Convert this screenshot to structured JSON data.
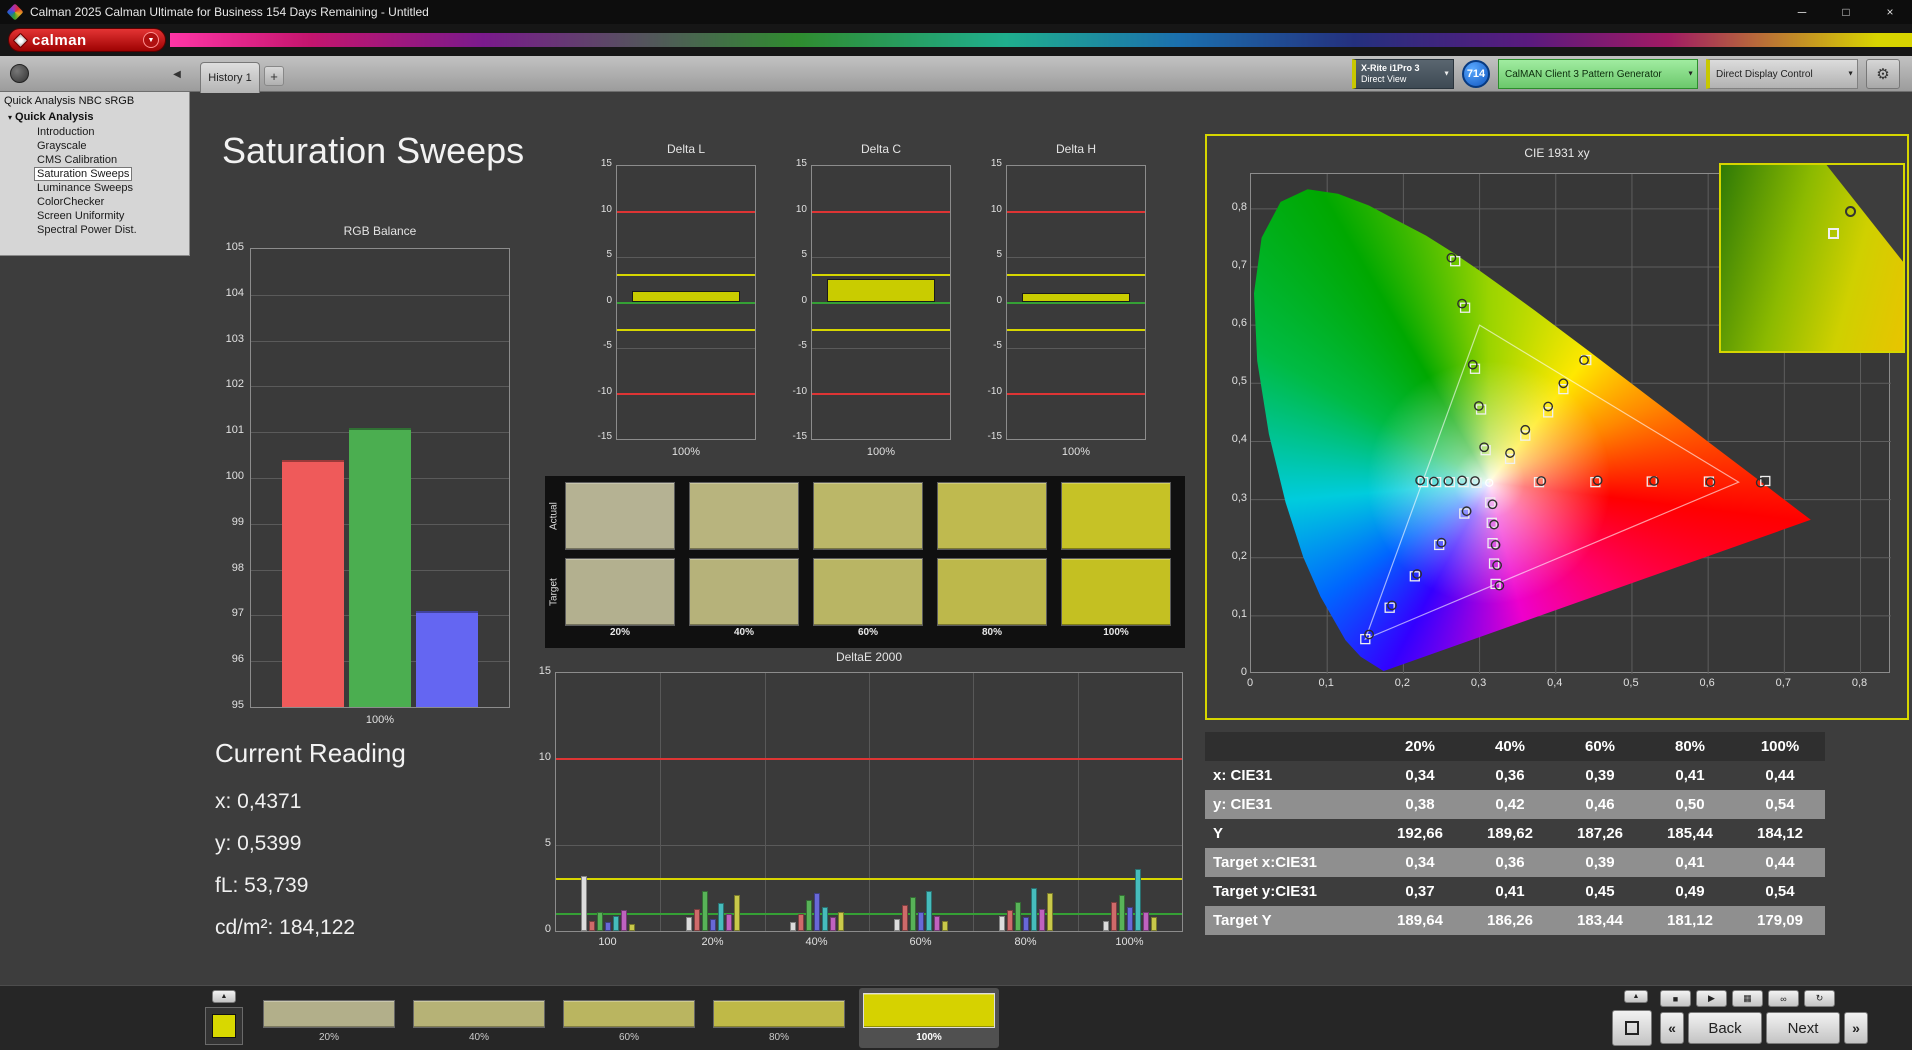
{
  "titlebar": {
    "title": "Calman 2025 Calman Ultimate for Business 154 Days Remaining  - Untitled"
  },
  "brand": {
    "name": "calman"
  },
  "tabbar": {
    "tab": "History 1"
  },
  "devices": {
    "meter_name": "X-Rite i1Pro 3",
    "meter_mode": "Direct View",
    "reading_count": "714",
    "pattern_generator": "CalMAN Client 3 Pattern Generator",
    "display_control": "Direct Display Control"
  },
  "sidebar": {
    "header": "Quick Analysis NBC sRGB",
    "root": "Quick Analysis",
    "items": [
      {
        "label": "Introduction",
        "selected": false
      },
      {
        "label": "Grayscale",
        "selected": false
      },
      {
        "label": "CMS Calibration",
        "selected": false
      },
      {
        "label": "Saturation Sweeps",
        "selected": true
      },
      {
        "label": "Luminance Sweeps",
        "selected": false
      },
      {
        "label": "ColorChecker",
        "selected": false
      },
      {
        "label": "Screen Uniformity",
        "selected": false
      },
      {
        "label": "Spectral Power Dist.",
        "selected": false
      }
    ]
  },
  "page_title": "Saturation Sweeps",
  "current_reading": {
    "heading": "Current Reading",
    "lines": [
      "x: 0,4371",
      "y: 0,5399",
      "fL: 53,739",
      "cd/m²: 184,122"
    ]
  },
  "nav": {
    "back": "Back",
    "next": "Next"
  },
  "icons": {
    "minimize": "─",
    "maximize": "□",
    "close": "×",
    "dropdown": "▼",
    "gear": "⚙",
    "collapse": "◀",
    "plus": "+",
    "expander": "▾",
    "up_arrow": "▲",
    "stop": "■",
    "play": "▶",
    "save": "▦",
    "loop": "∞",
    "refresh": "↻",
    "prev": "«",
    "next": "»"
  },
  "bottombar": {
    "toggle_color": "#d8d800",
    "swatches": [
      {
        "label": "20%",
        "color": "#b2af8a",
        "selected": false
      },
      {
        "label": "40%",
        "color": "#b6b276",
        "selected": false
      },
      {
        "label": "60%",
        "color": "#bab560",
        "selected": false
      },
      {
        "label": "80%",
        "color": "#bfb947",
        "selected": false
      },
      {
        "label": "100%",
        "color": "#d6d200",
        "selected": true
      }
    ]
  },
  "chart_data": [
    {
      "id": "rgb_balance",
      "type": "bar",
      "title": "RGB Balance",
      "xlabel": "100%",
      "categories": [
        "Red",
        "Green",
        "Blue"
      ],
      "values": [
        100.4,
        101.1,
        97.1
      ],
      "colors": [
        "#ef5a5a",
        "#4bae50",
        "#6466f2"
      ],
      "ylim": [
        95,
        105
      ],
      "yticks": [
        105,
        104,
        103,
        102,
        101,
        100,
        99,
        98,
        97,
        96,
        95
      ]
    },
    {
      "id": "delta_l",
      "type": "bar",
      "title": "Delta L",
      "xlabel": "100%",
      "value": 1.3,
      "bar_color": "#c9cc00",
      "ylim": [
        -15,
        15
      ],
      "yticks": [
        15,
        10,
        5,
        0,
        -5,
        -10,
        -15
      ],
      "limits": {
        "red": [
          10,
          -10
        ],
        "yellow": [
          3,
          -3
        ],
        "green": [
          0
        ]
      }
    },
    {
      "id": "delta_c",
      "type": "bar",
      "title": "Delta C",
      "xlabel": "100%",
      "value": 2.6,
      "bar_color": "#c9cc00",
      "ylim": [
        -15,
        15
      ],
      "yticks": [
        15,
        10,
        5,
        0,
        -5,
        -10,
        -15
      ],
      "limits": {
        "red": [
          10,
          -10
        ],
        "yellow": [
          3,
          -3
        ],
        "green": [
          0
        ]
      }
    },
    {
      "id": "delta_h",
      "type": "bar",
      "title": "Delta H",
      "xlabel": "100%",
      "value": 1.0,
      "bar_color": "#c9cc00",
      "ylim": [
        -15,
        15
      ],
      "yticks": [
        15,
        10,
        5,
        0,
        -5,
        -10,
        -15
      ],
      "limits": {
        "red": [
          10,
          -10
        ],
        "yellow": [
          3,
          -3
        ],
        "green": [
          0
        ]
      }
    },
    {
      "id": "saturation_swatches",
      "type": "swatch-table",
      "row_labels": [
        "Actual",
        "Target"
      ],
      "column_labels": [
        "20%",
        "40%",
        "60%",
        "80%",
        "100%"
      ],
      "actual": [
        "#b5b293",
        "#b8b47e",
        "#bbb768",
        "#bfba4f",
        "#c6c226"
      ],
      "target": [
        "#b3b08f",
        "#b6b27a",
        "#b9b564",
        "#bdb84b",
        "#c4c022"
      ]
    },
    {
      "id": "deltae_2000",
      "type": "grouped-bar",
      "title": "DeltaE 2000",
      "categories": [
        "100",
        "20%",
        "40%",
        "60%",
        "80%",
        "100%"
      ],
      "series_colors": [
        "#dcdcdc",
        "#cf6a6a",
        "#58b358",
        "#6868d8",
        "#46bcbc",
        "#bf62bf",
        "#c9c94a"
      ],
      "groups": [
        [
          3.2,
          0.6,
          1.1,
          0.5,
          0.9,
          1.2,
          0.4
        ],
        [
          0.8,
          1.3,
          2.3,
          0.7,
          1.6,
          1.0,
          2.1
        ],
        [
          0.5,
          1.0,
          1.8,
          2.2,
          1.4,
          0.8,
          1.1
        ],
        [
          0.7,
          1.5,
          2.0,
          1.1,
          2.3,
          0.9,
          0.6
        ],
        [
          0.9,
          1.2,
          1.7,
          0.8,
          2.5,
          1.3,
          2.2
        ],
        [
          0.6,
          1.7,
          2.1,
          1.4,
          3.6,
          1.1,
          0.8
        ]
      ],
      "ylim": [
        0,
        15
      ],
      "yticks": [
        15,
        10,
        5,
        0
      ],
      "limits": {
        "red": [
          10
        ],
        "yellow": [
          3
        ],
        "green": [
          1
        ]
      }
    },
    {
      "id": "cie_1931",
      "type": "scatter",
      "title": "CIE 1931 xy",
      "xlim": [
        0,
        0.8
      ],
      "ylim": [
        0,
        0.8
      ],
      "tick_values": [
        0,
        0.1,
        0.2,
        0.3,
        0.4,
        0.5,
        0.6,
        0.7,
        0.8
      ],
      "tick_labels": [
        "0",
        "0,1",
        "0,2",
        "0,3",
        "0,4",
        "0,5",
        "0,6",
        "0,7",
        "0,8"
      ],
      "white_point": [
        0.3127,
        0.329
      ],
      "gamut_triangle": [
        [
          0.64,
          0.33
        ],
        [
          0.3,
          0.6
        ],
        [
          0.15,
          0.06
        ]
      ],
      "sweeps": [
        {
          "name": "red",
          "targets": [
            [
              0.378,
              0.33
            ],
            [
              0.452,
              0.33
            ],
            [
              0.526,
              0.331
            ],
            [
              0.601,
              0.331
            ],
            [
              0.675,
              0.332
            ]
          ],
          "measured": [
            [
              0.381,
              0.332
            ],
            [
              0.455,
              0.333
            ],
            [
              0.529,
              0.332
            ],
            [
              0.603,
              0.33
            ],
            [
              0.669,
              0.329
            ]
          ]
        },
        {
          "name": "green",
          "targets": [
            [
              0.308,
              0.385
            ],
            [
              0.302,
              0.455
            ],
            [
              0.294,
              0.525
            ],
            [
              0.281,
              0.63
            ],
            [
              0.268,
              0.71
            ]
          ],
          "measured": [
            [
              0.306,
              0.39
            ],
            [
              0.299,
              0.461
            ],
            [
              0.291,
              0.532
            ],
            [
              0.277,
              0.637
            ],
            [
              0.263,
              0.716
            ]
          ]
        },
        {
          "name": "blue",
          "targets": [
            [
              0.28,
              0.276
            ],
            [
              0.247,
              0.222
            ],
            [
              0.215,
              0.168
            ],
            [
              0.182,
              0.114
            ],
            [
              0.15,
              0.06
            ]
          ],
          "measured": [
            [
              0.283,
              0.28
            ],
            [
              0.25,
              0.226
            ],
            [
              0.218,
              0.172
            ],
            [
              0.185,
              0.118
            ],
            [
              0.155,
              0.068
            ]
          ]
        },
        {
          "name": "cyan",
          "targets": [
            [
              0.296,
              0.329
            ],
            [
              0.279,
              0.33
            ],
            [
              0.261,
              0.33
            ],
            [
              0.243,
              0.33
            ],
            [
              0.226,
              0.33
            ]
          ],
          "measured": [
            [
              0.294,
              0.332
            ],
            [
              0.277,
              0.333
            ],
            [
              0.259,
              0.332
            ],
            [
              0.24,
              0.331
            ],
            [
              0.222,
              0.333
            ]
          ]
        },
        {
          "name": "magenta",
          "targets": [
            [
              0.314,
              0.295
            ],
            [
              0.316,
              0.26
            ],
            [
              0.317,
              0.225
            ],
            [
              0.319,
              0.19
            ],
            [
              0.321,
              0.155
            ]
          ],
          "measured": [
            [
              0.317,
              0.292
            ],
            [
              0.319,
              0.257
            ],
            [
              0.321,
              0.222
            ],
            [
              0.323,
              0.187
            ],
            [
              0.326,
              0.152
            ]
          ]
        },
        {
          "name": "yellow",
          "targets": [
            [
              0.34,
              0.37
            ],
            [
              0.36,
              0.41
            ],
            [
              0.39,
              0.45
            ],
            [
              0.41,
              0.49
            ],
            [
              0.44,
              0.54
            ]
          ],
          "measured": [
            [
              0.34,
              0.38
            ],
            [
              0.36,
              0.42
            ],
            [
              0.39,
              0.46
            ],
            [
              0.41,
              0.5
            ],
            [
              0.4371,
              0.5399
            ]
          ]
        }
      ]
    },
    {
      "id": "saturation_table",
      "type": "table",
      "columns": [
        "",
        "20%",
        "40%",
        "60%",
        "80%",
        "100%"
      ],
      "rows": [
        {
          "label": "x: CIE31",
          "values": [
            "0,34",
            "0,36",
            "0,39",
            "0,41",
            "0,44"
          ]
        },
        {
          "label": "y: CIE31",
          "values": [
            "0,38",
            "0,42",
            "0,46",
            "0,50",
            "0,54"
          ]
        },
        {
          "label": "Y",
          "values": [
            "192,66",
            "189,62",
            "187,26",
            "185,44",
            "184,12"
          ]
        },
        {
          "label": "Target x:CIE31",
          "values": [
            "0,34",
            "0,36",
            "0,39",
            "0,41",
            "0,44"
          ]
        },
        {
          "label": "Target y:CIE31",
          "values": [
            "0,37",
            "0,41",
            "0,45",
            "0,49",
            "0,54"
          ]
        },
        {
          "label": "Target Y",
          "values": [
            "189,64",
            "186,26",
            "183,44",
            "181,12",
            "179,09"
          ]
        }
      ]
    }
  ]
}
